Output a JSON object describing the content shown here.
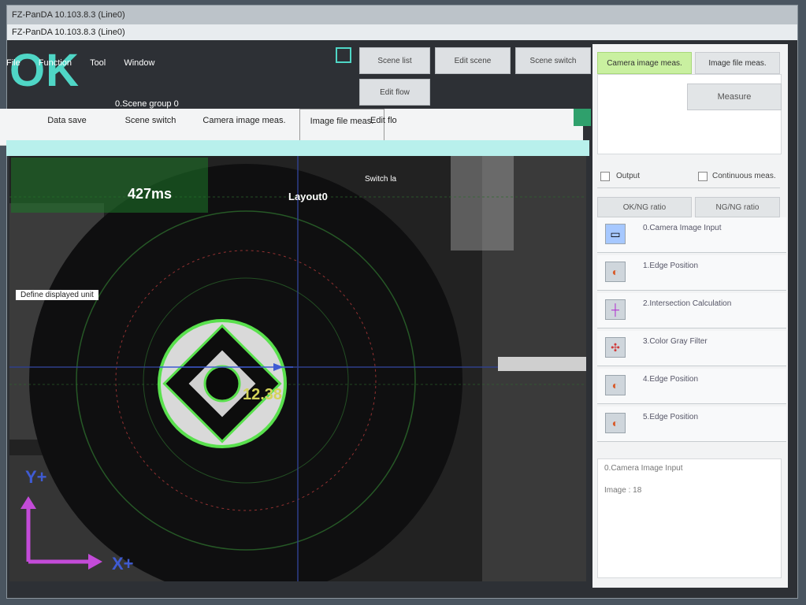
{
  "window": {
    "title_faded": "FZ-PanDA 10.103.8.3 (Line0)",
    "title": "FZ-PanDA 10.103.8.3 (Line0)"
  },
  "menu": {
    "items": [
      "File",
      "Function",
      "Tool",
      "Window"
    ]
  },
  "judgement": {
    "label": "OK"
  },
  "scene": {
    "group": "0.Scene group 0"
  },
  "toolbar": {
    "buttons": [
      "Data save",
      "Scene switch",
      "Camera image meas.",
      "Image file meas."
    ],
    "edit_flow": "Edit flo",
    "switch_layout": "Switch la"
  },
  "status": {
    "time": "427ms",
    "layout": "Layout0",
    "define_unit": "Define displayed unit"
  },
  "measurement": {
    "value_label": "12.38"
  },
  "axes": {
    "y": "Y+",
    "x": "X+"
  },
  "right_panel": {
    "top_buttons": [
      "Scene list",
      "Edit scene",
      "Scene switch",
      "Edit flow"
    ],
    "tabs": [
      "Camera image meas.",
      "Image file meas."
    ],
    "action_button": "Measure",
    "output": "Output",
    "continuous_meas": "Continuous meas.",
    "ng_label_a": "OK/NG ratio",
    "ng_label_b": "NG/NG ratio",
    "flow_items": [
      {
        "label": "0.Camera Image Input",
        "icon": "camera-icon"
      },
      {
        "label": "1.Edge Position",
        "icon": "edge-icon"
      },
      {
        "label": "2.Intersection Calculation",
        "icon": "intersection-icon"
      },
      {
        "label": "3.Color Gray Filter",
        "icon": "filter-icon"
      },
      {
        "label": "4.Edge Position",
        "icon": "edge-icon"
      },
      {
        "label": "5.Edge Position",
        "icon": "edge-icon"
      }
    ],
    "detail_title": "0.Camera Image Input",
    "detail_value": "Image : 18"
  },
  "colors": {
    "ok": "#4fd6c6",
    "active_tab": "#c9f0a0",
    "overlay_green": "#59e04d",
    "axis_blue": "#3f5bd3",
    "axis_magenta": "#c34bd8",
    "value_yellow": "#d4d45a"
  }
}
